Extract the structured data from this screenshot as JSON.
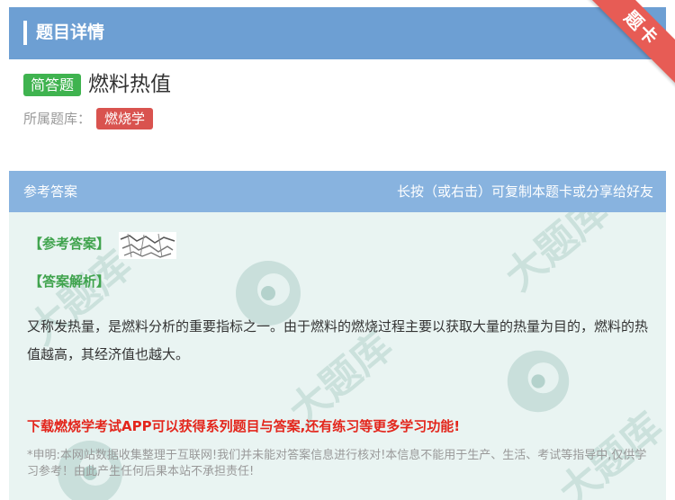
{
  "header": {
    "title": "题目详情",
    "ribbon": "题卡"
  },
  "question": {
    "type_badge": "简答题",
    "title": "燃料热值",
    "library_label": "所属题库：",
    "library_tag": "燃烧学"
  },
  "answer_section": {
    "head_left": "参考答案",
    "head_right": "长按（或右击）可复制本题卡或分享给好友",
    "answer_label": "【参考答案】",
    "analysis_label": "【答案解析】",
    "analysis_text": "又称发热量，是燃料分析的重要指标之一。由于燃料的燃烧过程主要以获取大量的热量为目的，燃料的热值越高，其经济值也越大。",
    "promo": "下载燃烧学考试APP可以获得系列题目与答案,还有练习等更多学习功能!",
    "disclaimer": "*申明:本网站数据收集整理于互联网!我们并未能对答案信息进行核对!本信息不能用于生产、生活、考试等指导中,仅供学习参考！由此产生任何后果本站不承担责任!"
  },
  "colors": {
    "header_bg": "#6d9fd3",
    "answer_head_bg": "#88b3df",
    "answer_body_bg": "#e9f4f2",
    "badge_green": "#3fb34f",
    "tag_red": "#d9534f",
    "ribbon_red": "#e75c55",
    "promo_red": "#e3261c"
  }
}
